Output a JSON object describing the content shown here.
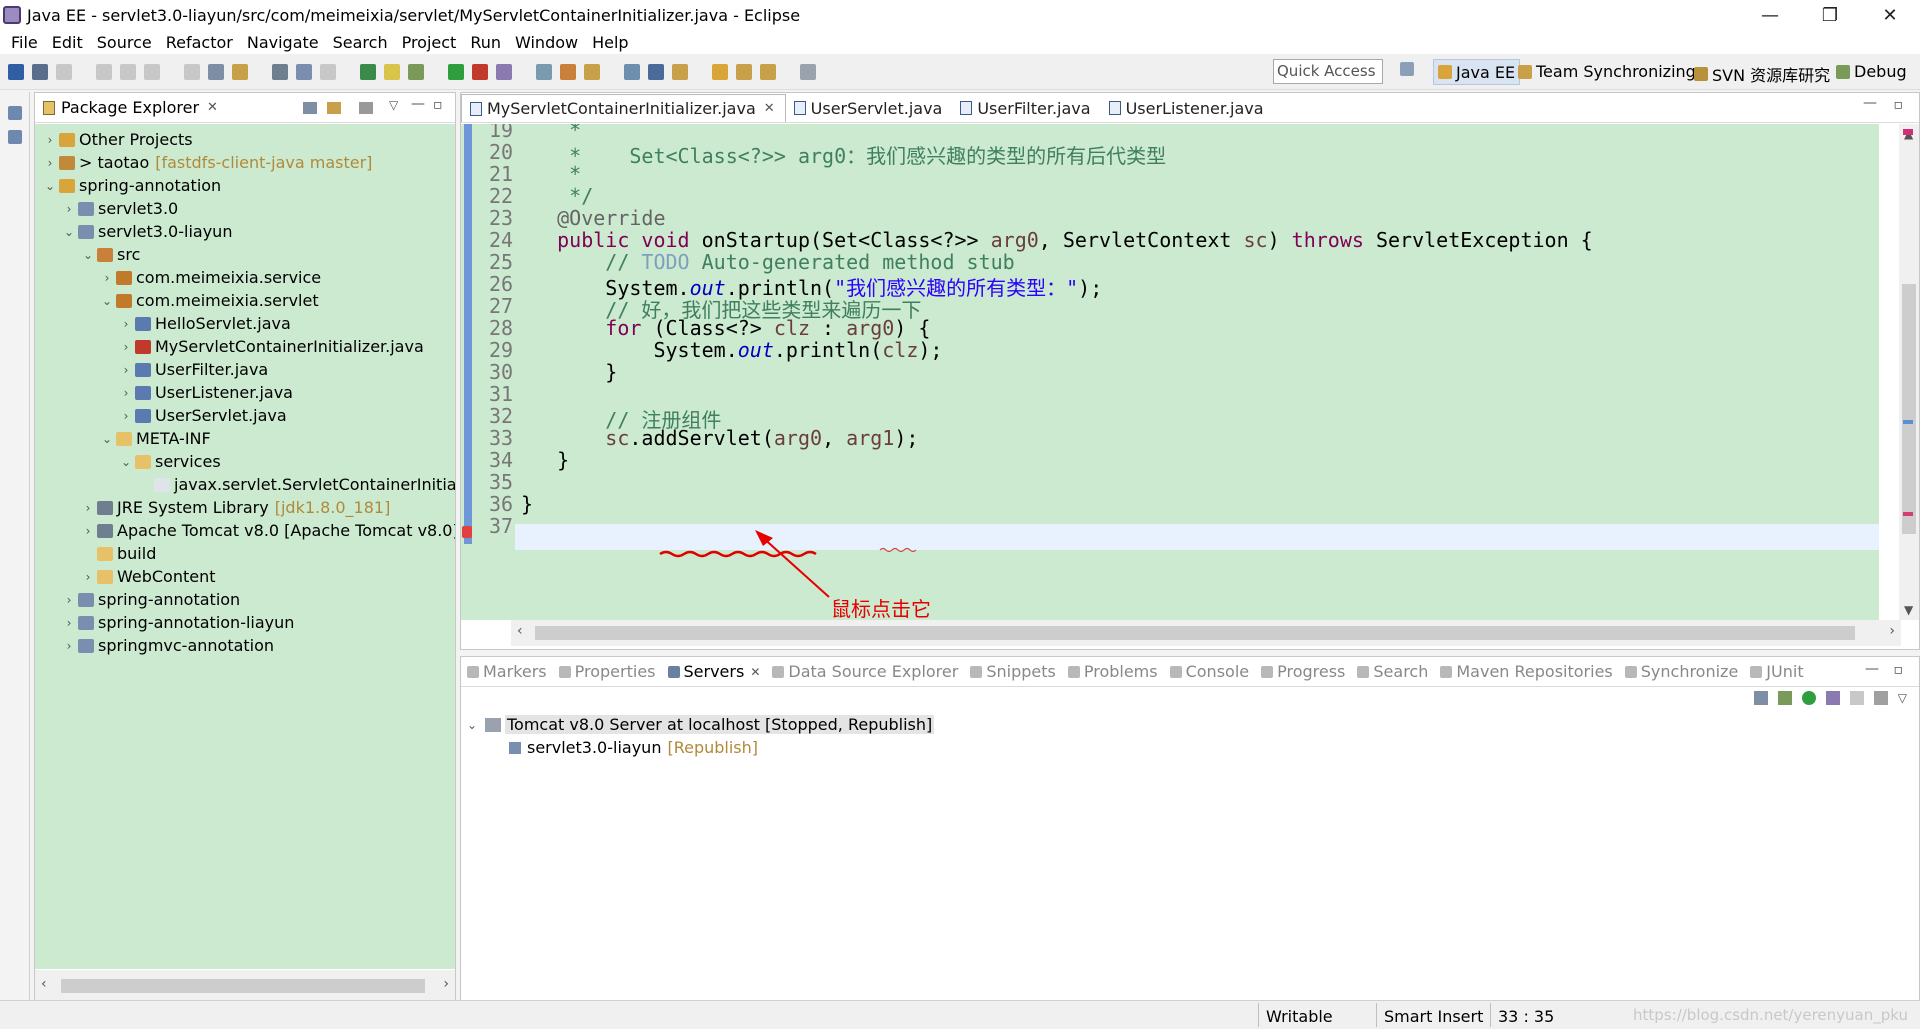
{
  "window": {
    "title": "Java EE - servlet3.0-liayun/src/com/meimeixia/servlet/MyServletContainerInitializer.java - Eclipse",
    "controls": [
      "—",
      "❐",
      "✕"
    ]
  },
  "menu": [
    "File",
    "Edit",
    "Source",
    "Refactor",
    "Navigate",
    "Search",
    "Project",
    "Run",
    "Window",
    "Help"
  ],
  "toolbar": {
    "quick_access_placeholder": "Quick Access",
    "perspectives": [
      "Java EE",
      "Team Synchronizing",
      "SVN 资源库研究",
      "Debug"
    ]
  },
  "package_explorer": {
    "title": "Package Explorer",
    "items": [
      {
        "label": "Other Projects",
        "dec": "",
        "level": 0,
        "arrow": "›",
        "icon": "working-set-icon",
        "color": "#d9a53a"
      },
      {
        "label": "> taotao",
        "dec": "[fastdfs-client-java master]",
        "level": 0,
        "arrow": "›",
        "icon": "project-icon",
        "color": "#c08a3a"
      },
      {
        "label": "spring-annotation",
        "dec": "",
        "level": 0,
        "arrow": "⌄",
        "icon": "working-set-icon",
        "color": "#d9a53a"
      },
      {
        "label": "servlet3.0",
        "dec": "",
        "level": 1,
        "arrow": "›",
        "icon": "web-project-icon",
        "color": "#7a8fb0"
      },
      {
        "label": "servlet3.0-liayun",
        "dec": "",
        "level": 1,
        "arrow": "⌄",
        "icon": "web-project-icon",
        "color": "#7a8fb0"
      },
      {
        "label": "src",
        "dec": "",
        "level": 2,
        "arrow": "⌄",
        "icon": "source-folder-icon",
        "color": "#c9803a"
      },
      {
        "label": "com.meimeixia.service",
        "dec": "",
        "level": 3,
        "arrow": "›",
        "icon": "package-icon",
        "color": "#c07a2a"
      },
      {
        "label": "com.meimeixia.servlet",
        "dec": "",
        "level": 3,
        "arrow": "⌄",
        "icon": "package-icon",
        "color": "#c07a2a"
      },
      {
        "label": "HelloServlet.java",
        "dec": "",
        "level": 4,
        "arrow": "›",
        "icon": "java-file-icon",
        "color": "#5a7ab0"
      },
      {
        "label": "MyServletContainerInitializer.java",
        "dec": "",
        "level": 4,
        "arrow": "›",
        "icon": "java-file-icon",
        "color": "#c0392b"
      },
      {
        "label": "UserFilter.java",
        "dec": "",
        "level": 4,
        "arrow": "›",
        "icon": "java-file-icon",
        "color": "#5a7ab0"
      },
      {
        "label": "UserListener.java",
        "dec": "",
        "level": 4,
        "arrow": "›",
        "icon": "java-file-icon",
        "color": "#5a7ab0"
      },
      {
        "label": "UserServlet.java",
        "dec": "",
        "level": 4,
        "arrow": "›",
        "icon": "java-file-icon",
        "color": "#5a7ab0"
      },
      {
        "label": "META-INF",
        "dec": "",
        "level": 3,
        "arrow": "⌄",
        "icon": "folder-icon",
        "color": "#e6c168"
      },
      {
        "label": "services",
        "dec": "",
        "level": 4,
        "arrow": "⌄",
        "icon": "folder-icon",
        "color": "#e6c168"
      },
      {
        "label": "javax.servlet.ServletContainerInitializer",
        "dec": "",
        "level": 5,
        "arrow": "",
        "icon": "file-icon",
        "color": "#dfe4ea"
      },
      {
        "label": "JRE System Library",
        "dec": "[jdk1.8.0_181]",
        "level": 2,
        "arrow": "›",
        "icon": "library-icon",
        "color": "#6f7f8f"
      },
      {
        "label": "Apache Tomcat v8.0 [Apache Tomcat v8.0]",
        "dec": "",
        "level": 2,
        "arrow": "›",
        "icon": "library-icon",
        "color": "#6f7f8f"
      },
      {
        "label": "build",
        "dec": "",
        "level": 2,
        "arrow": "",
        "icon": "folder-icon",
        "color": "#e6c168"
      },
      {
        "label": "WebContent",
        "dec": "",
        "level": 2,
        "arrow": "›",
        "icon": "folder-icon",
        "color": "#e6c168"
      },
      {
        "label": "spring-annotation",
        "dec": "",
        "level": 1,
        "arrow": "›",
        "icon": "web-project-icon",
        "color": "#7a8fb0"
      },
      {
        "label": "spring-annotation-liayun",
        "dec": "",
        "level": 1,
        "arrow": "›",
        "icon": "web-project-icon",
        "color": "#7a8fb0"
      },
      {
        "label": "springmvc-annotation",
        "dec": "",
        "level": 1,
        "arrow": "›",
        "icon": "web-project-icon",
        "color": "#7a8fb0"
      }
    ]
  },
  "editor": {
    "tabs": [
      {
        "label": "MyServletContainerInitializer.java",
        "active": true
      },
      {
        "label": "UserServlet.java",
        "active": false
      },
      {
        "label": "UserFilter.java",
        "active": false
      },
      {
        "label": "UserListener.java",
        "active": false
      }
    ],
    "lines": [
      {
        "n": "19",
        "segs": [
          [
            "cm",
            "    *"
          ]
        ]
      },
      {
        "n": "20",
        "segs": [
          [
            "cm",
            "    *    Set<Class<?>> arg0：我们感兴趣的类型的所有后代类型"
          ]
        ]
      },
      {
        "n": "21",
        "segs": [
          [
            "cm",
            "    *"
          ]
        ]
      },
      {
        "n": "22",
        "segs": [
          [
            "cm",
            "    */"
          ]
        ]
      },
      {
        "n": "23",
        "segs": [
          [
            "ann",
            "   @Override"
          ]
        ]
      },
      {
        "n": "24",
        "segs": [
          [
            "kw",
            "   public void "
          ],
          [
            "",
            "onStartup(Set<Class<?>> "
          ],
          [
            "var",
            "arg0"
          ],
          [
            "",
            ", ServletContext "
          ],
          [
            "var",
            "sc"
          ],
          [
            "",
            ") "
          ],
          [
            "kw",
            "throws"
          ],
          [
            "",
            " ServletException {"
          ]
        ]
      },
      {
        "n": "25",
        "segs": [
          [
            "cm",
            "       // "
          ],
          [
            "todo",
            "TODO"
          ],
          [
            "cm",
            " Auto-generated method stub"
          ]
        ]
      },
      {
        "n": "26",
        "segs": [
          [
            "",
            "       System."
          ],
          [
            "fld",
            "out"
          ],
          [
            "",
            ".println("
          ],
          [
            "st",
            "\"我们感兴趣的所有类型：\""
          ],
          [
            "",
            ");"
          ]
        ]
      },
      {
        "n": "27",
        "segs": [
          [
            "cm",
            "       // 好，我们把这些类型来遍历一下"
          ]
        ]
      },
      {
        "n": "28",
        "segs": [
          [
            "kw",
            "       for"
          ],
          [
            "",
            " (Class<?> "
          ],
          [
            "var",
            "clz"
          ],
          [
            "",
            " : "
          ],
          [
            "var",
            "arg0"
          ],
          [
            "",
            ") {"
          ]
        ]
      },
      {
        "n": "29",
        "segs": [
          [
            "",
            "           System."
          ],
          [
            "fld",
            "out"
          ],
          [
            "",
            ".println("
          ],
          [
            "var",
            "clz"
          ],
          [
            "",
            ");"
          ]
        ]
      },
      {
        "n": "30",
        "segs": [
          [
            "",
            "       }"
          ]
        ]
      },
      {
        "n": "31",
        "segs": [
          [
            "",
            ""
          ]
        ]
      },
      {
        "n": "32",
        "segs": [
          [
            "cm",
            "       // 注册组件"
          ]
        ]
      },
      {
        "n": "33",
        "segs": [
          [
            "",
            "       "
          ],
          [
            "var",
            "sc"
          ],
          [
            "",
            ".addServlet("
          ],
          [
            "var",
            "arg0"
          ],
          [
            "",
            ", "
          ],
          [
            "var",
            "arg1"
          ],
          [
            "",
            ");"
          ]
        ]
      },
      {
        "n": "34",
        "segs": [
          [
            "",
            "   }"
          ]
        ]
      },
      {
        "n": "35",
        "segs": [
          [
            "",
            ""
          ]
        ]
      },
      {
        "n": "36",
        "segs": [
          [
            "",
            "}"
          ]
        ]
      },
      {
        "n": "37",
        "segs": [
          [
            "",
            ""
          ]
        ]
      }
    ],
    "annotation": "鼠标点击它"
  },
  "bottom_panel": {
    "tabs": [
      {
        "label": "Markers",
        "active": false
      },
      {
        "label": "Properties",
        "active": false
      },
      {
        "label": "Servers",
        "active": true
      },
      {
        "label": "Data Source Explorer",
        "active": false
      },
      {
        "label": "Snippets",
        "active": false
      },
      {
        "label": "Problems",
        "active": false
      },
      {
        "label": "Console",
        "active": false
      },
      {
        "label": "Progress",
        "active": false
      },
      {
        "label": "Search",
        "active": false
      },
      {
        "label": "Maven Repositories",
        "active": false
      },
      {
        "label": "Synchronize",
        "active": false
      },
      {
        "label": "JUnit",
        "active": false
      }
    ],
    "server": {
      "label": "Tomcat v8.0 Server at localhost  [Stopped, Republish]"
    },
    "module": {
      "label": "servlet3.0-liayun",
      "dec": "[Republish]"
    }
  },
  "status": {
    "writable": "Writable",
    "insert_mode": "Smart Insert",
    "position": "33 : 35",
    "watermark": "https://blog.csdn.net/yerenyuan_pku"
  },
  "colors": {
    "editor_bg": "#ccead0",
    "annotation_red": "#e60000",
    "current_line": "#e8f2fe"
  }
}
